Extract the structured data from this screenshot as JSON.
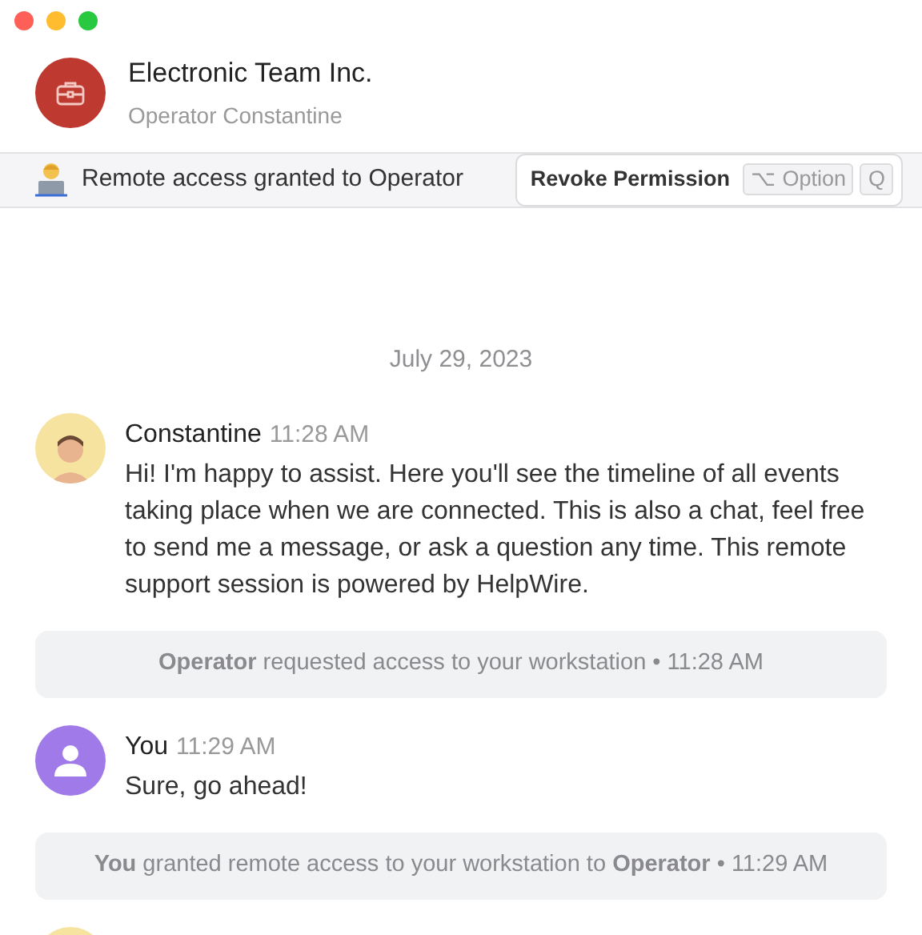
{
  "header": {
    "title": "Electronic Team Inc.",
    "subtitle": "Operator Constantine"
  },
  "banner": {
    "text": "Remote access granted to Operator",
    "button": {
      "label": "Revoke Permission",
      "keys": [
        "⌥ Option",
        "Q"
      ]
    }
  },
  "date": "July 29, 2023",
  "timeline": [
    {
      "kind": "message",
      "avatar": {
        "kind": "memoji"
      },
      "author": "Constantine",
      "time": "11:28 AM",
      "text": "Hi! I'm happy to assist. Here you'll see the timeline of all events taking place when we are connected. This is also a chat, feel free to send me a message, or ask a question any time. This remote support session is powered by HelpWire."
    },
    {
      "kind": "event",
      "text": "**Operator** requested access to your workstation • 11:28 AM"
    },
    {
      "kind": "message",
      "avatar": {
        "kind": "user"
      },
      "author": "You",
      "time": "11:29 AM",
      "text": "Sure, go ahead!"
    },
    {
      "kind": "event",
      "text": "**You** granted remote access to your workstation to **Operator** • 11:29 AM"
    },
    {
      "kind": "partial",
      "avatar": {
        "kind": "memoji"
      }
    }
  ]
}
